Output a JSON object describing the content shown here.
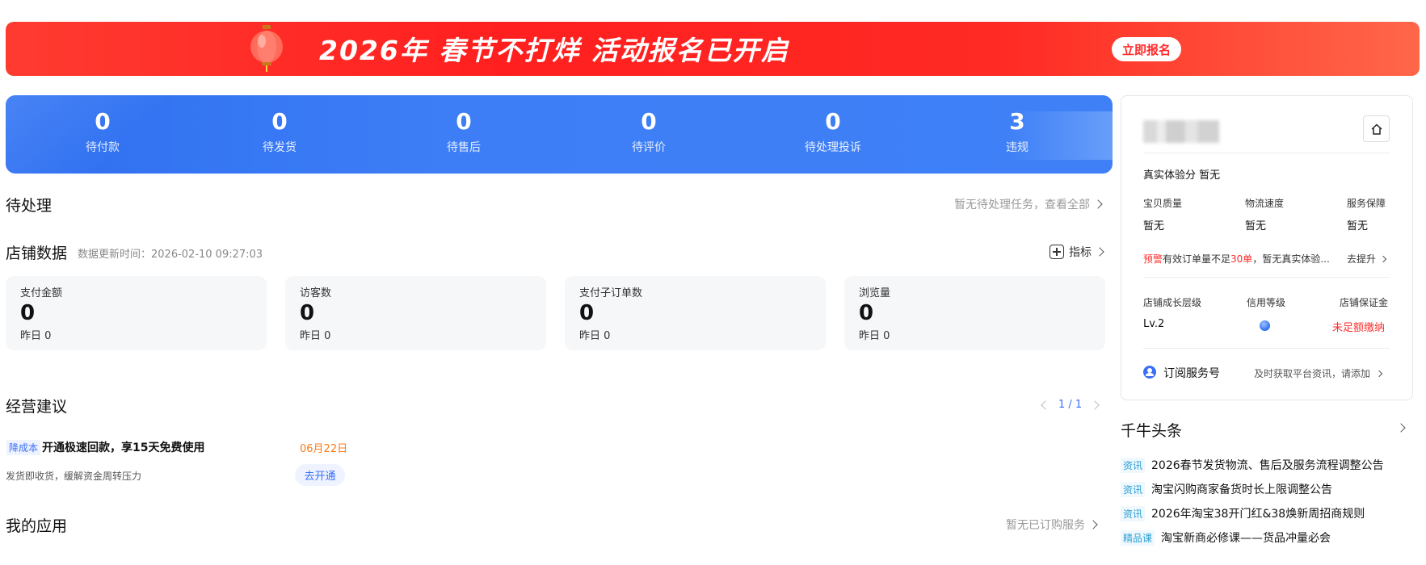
{
  "banner": {
    "title": "2026年 春节不打烊 活动报名已开启",
    "cta": "立即报名"
  },
  "stats": [
    {
      "value": "0",
      "label": "待付款"
    },
    {
      "value": "0",
      "label": "待发货"
    },
    {
      "value": "0",
      "label": "待售后"
    },
    {
      "value": "0",
      "label": "待评价"
    },
    {
      "value": "0",
      "label": "待处理投诉"
    },
    {
      "value": "3",
      "label": "违规"
    }
  ],
  "pending": {
    "title": "待处理",
    "link": "暂无待处理任务，查看全部"
  },
  "shop_data": {
    "title": "店铺数据",
    "update_time": "数据更新时间：2026-02-10 09:27:03",
    "indicator": "指标",
    "cards": [
      {
        "label": "支付金额",
        "value": "0",
        "yesterday": "昨日 0"
      },
      {
        "label": "访客数",
        "value": "0",
        "yesterday": "昨日 0"
      },
      {
        "label": "支付子订单数",
        "value": "0",
        "yesterday": "昨日 0"
      },
      {
        "label": "浏览量",
        "value": "0",
        "yesterday": "昨日 0"
      }
    ]
  },
  "advice": {
    "title": "经营建议",
    "pager": "1 / 1",
    "item": {
      "tag": "降成本",
      "title": "开通极速回款，享15天免费使用",
      "date": "06月22日",
      "desc": "发货即收货，缓解资金周转压力",
      "button": "去开通"
    }
  },
  "apps": {
    "title": "我的应用",
    "link": "暂无已订购服务"
  },
  "panel": {
    "experience_label": "真实体验分",
    "experience_value": "暂无",
    "metrics": [
      {
        "label": "宝贝质量",
        "value": "暂无"
      },
      {
        "label": "物流速度",
        "value": "暂无"
      },
      {
        "label": "服务保障",
        "value": "暂无"
      }
    ],
    "warning": {
      "tag": "预警",
      "text_a": "有效订单量不足",
      "count": "30单",
      "text_b": "，暂无真实体验...",
      "link": "去提升"
    },
    "growth": [
      {
        "label": "店铺成长层级",
        "value": "Lv.2"
      },
      {
        "label": "信用等级",
        "value": ""
      },
      {
        "label": "店铺保证金",
        "value": "未足额缴纳"
      }
    ],
    "subscribe": {
      "label": "订阅服务号",
      "hint": "及时获取平台资讯，请添加"
    }
  },
  "news": {
    "title": "千牛头条",
    "items": [
      {
        "tag": "资讯",
        "text": "2026春节发货物流、售后及服务流程调整公告"
      },
      {
        "tag": "资讯",
        "text": "淘宝闪购商家备货时长上限调整公告"
      },
      {
        "tag": "资讯",
        "text": "2026年淘宝38开门红&38焕新周招商规则"
      },
      {
        "tag": "精品课",
        "text": "淘宝新商必修课——货品冲量必会"
      }
    ]
  },
  "colors": {
    "accent_blue": "#3b6ff5",
    "banner_red": "#ff1f1f",
    "warning_red": "#ff2d2d",
    "date_orange": "#ff7a1a"
  }
}
